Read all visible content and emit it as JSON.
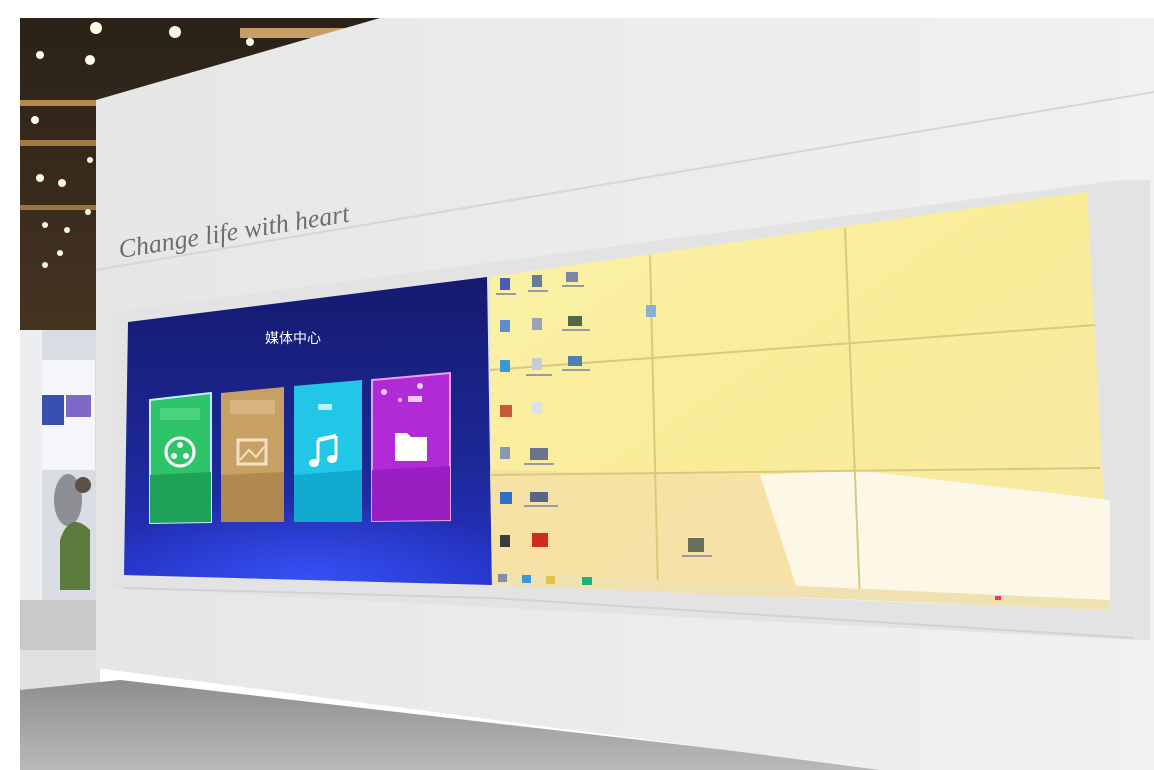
{
  "scene": {
    "slogan": "Change life with heart",
    "media_center_title": "媒体中心",
    "tiles": [
      {
        "icon": "film-reel-icon",
        "color": "#2fc46a"
      },
      {
        "icon": "picture-icon",
        "color": "#c7a064"
      },
      {
        "icon": "music-note-icon",
        "color": "#22c6e6"
      },
      {
        "icon": "folder-icon",
        "color": "#b02bd6"
      }
    ],
    "colors": {
      "wall": "#efefef",
      "media_bg": "#1a1f8c",
      "desktop_bg": "#f8ec9a"
    }
  }
}
